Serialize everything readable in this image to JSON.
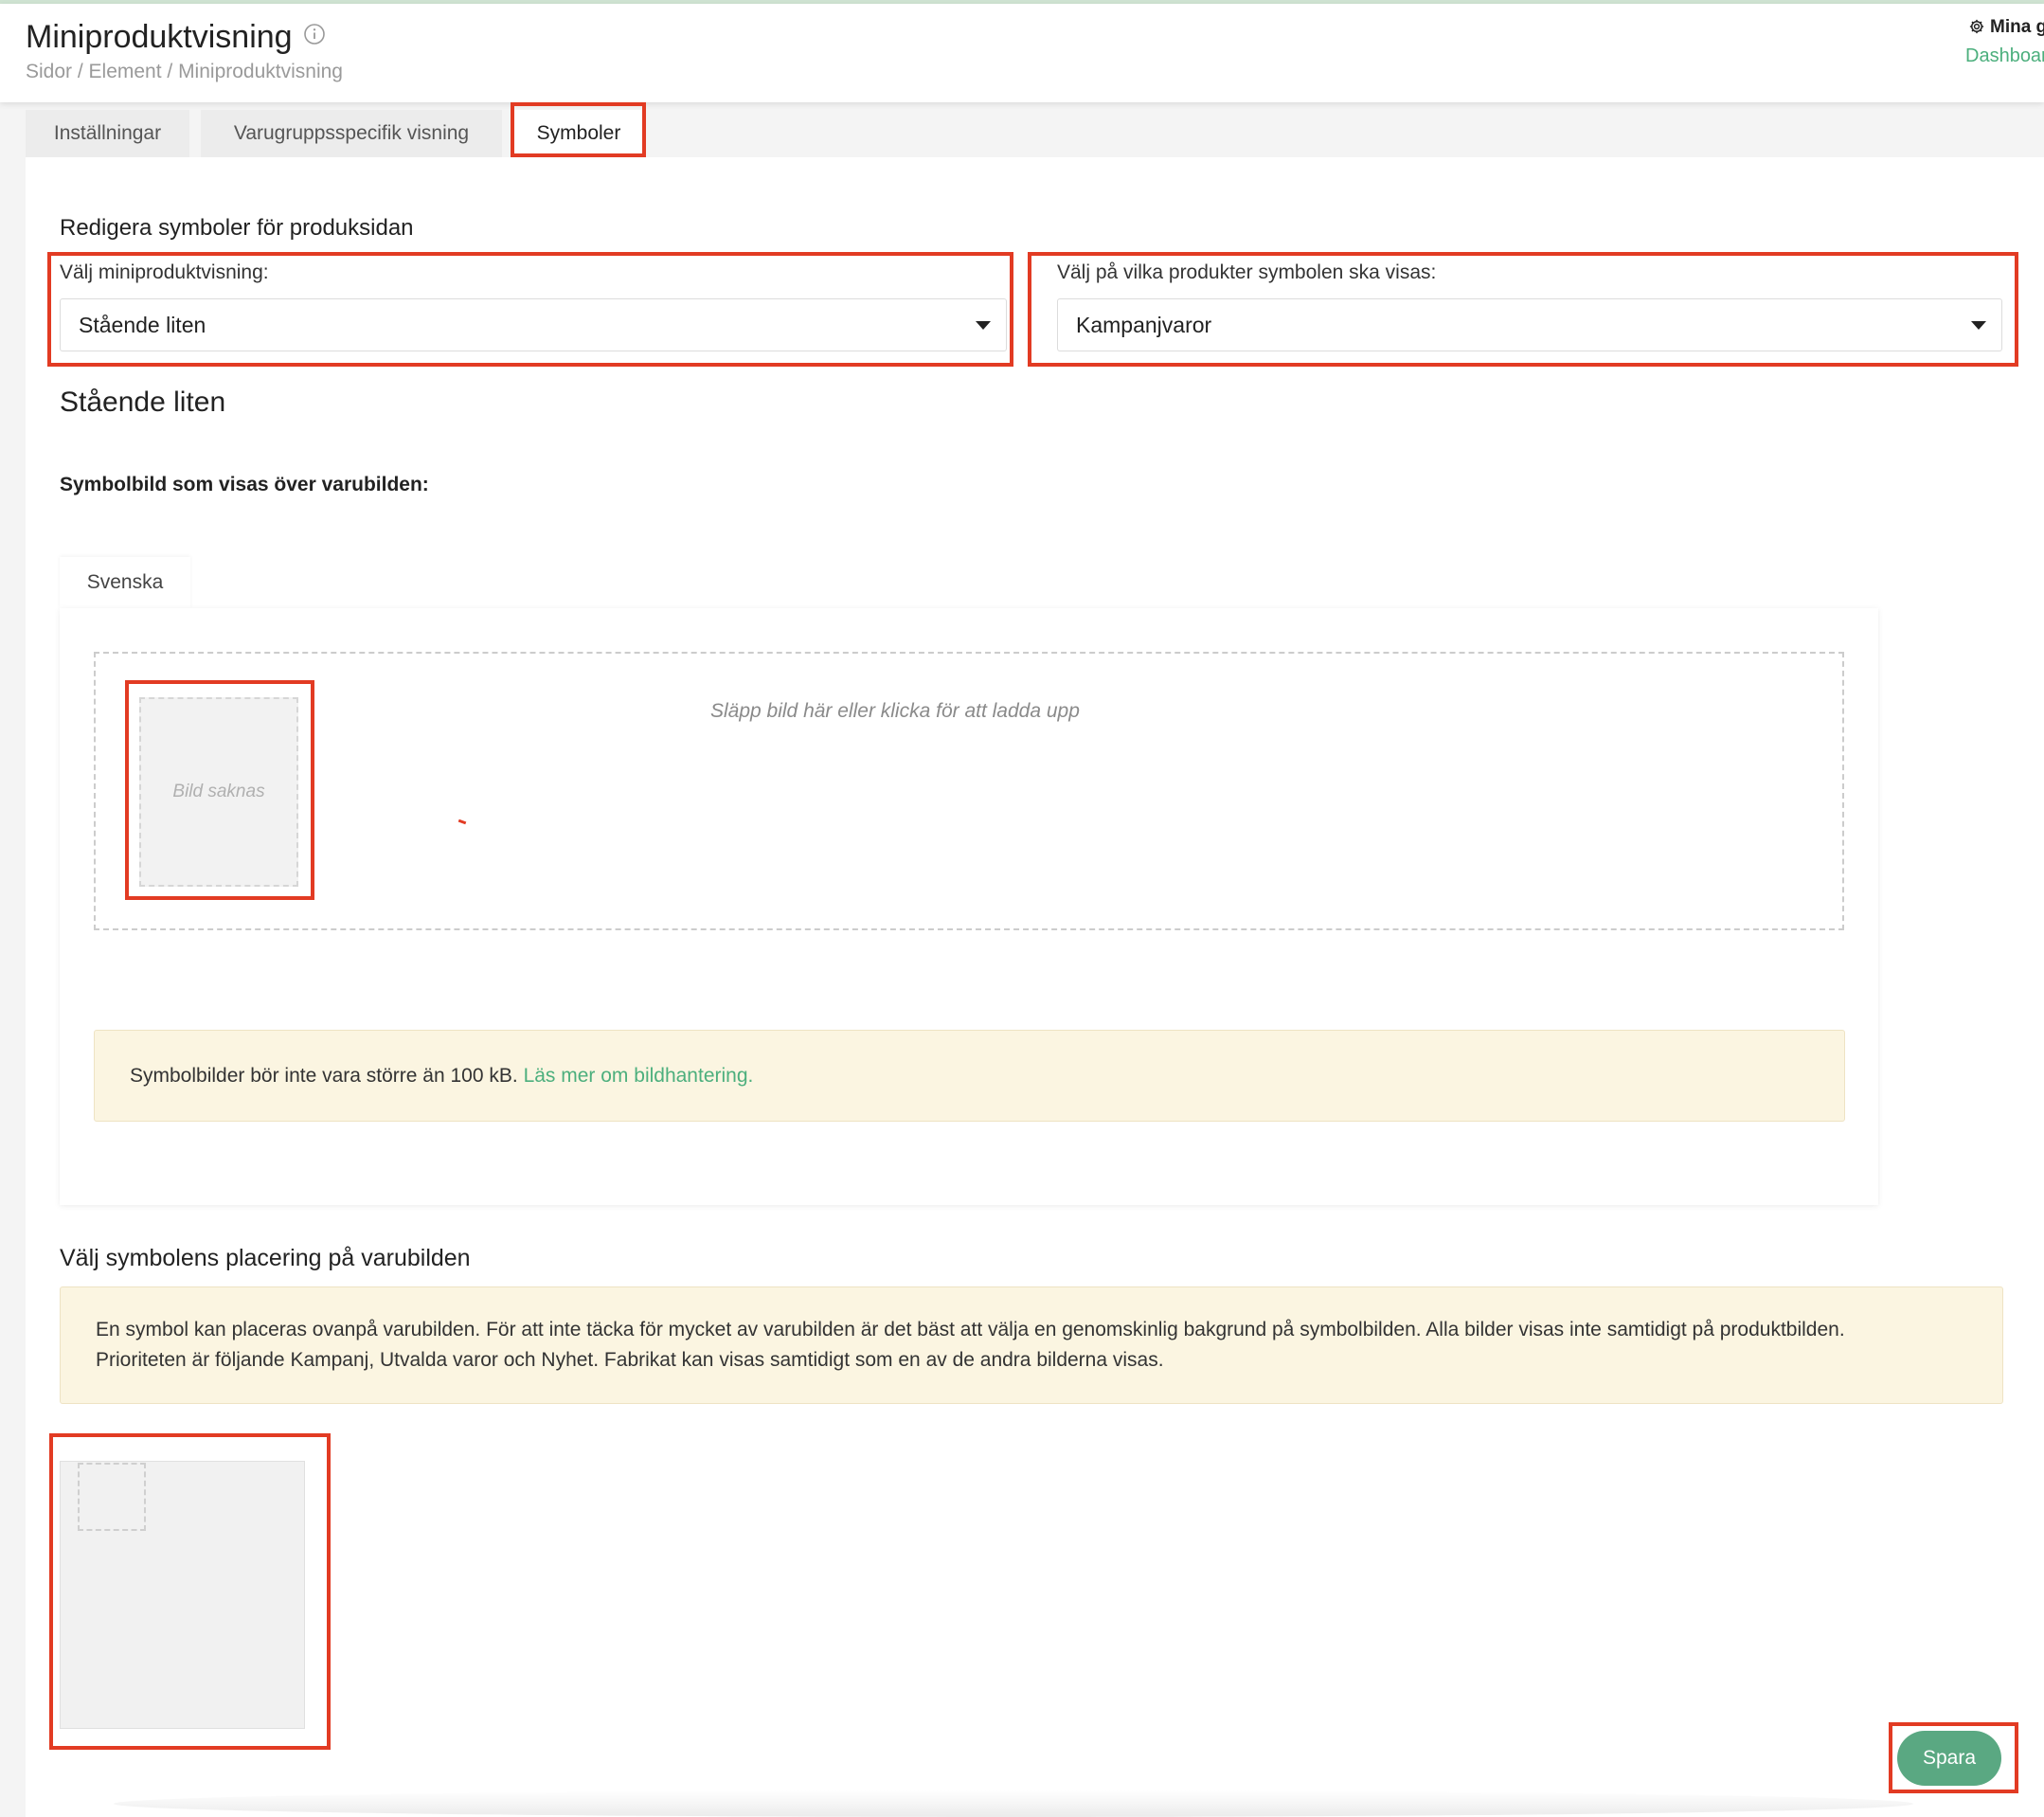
{
  "header": {
    "title": "Miniproduktvisning",
    "breadcrumb": "Sidor / Element / Miniproduktvisning",
    "top_right_label": "Mina g",
    "top_right_link": "Dashboar"
  },
  "tabs": [
    {
      "label": "Inställningar",
      "active": false
    },
    {
      "label": "Varugruppsspecifik visning",
      "active": false
    },
    {
      "label": "Symboler",
      "active": true
    }
  ],
  "section": {
    "heading": "Redigera symboler för produksidan",
    "miniview_label": "Välj miniproduktvisning:",
    "miniview_value": "Stående liten",
    "products_label": "Välj på vilka produkter symbolen ska visas:",
    "products_value": "Kampanjvaror",
    "subheading": "Stående liten",
    "symbol_label": "Symbolbild som visas över varubilden:",
    "language_tab": "Svenska",
    "dropzone_text": "Släpp bild här eller klicka för att ladda upp",
    "missing_image_text": "Bild saknas",
    "size_note": "Symbolbilder bör inte vara större än 100 kB.",
    "size_note_link": "Läs mer om bildhantering."
  },
  "placement": {
    "heading": "Välj symbolens placering på varubilden",
    "note_line1": "En symbol kan placeras ovanpå varubilden. För att inte täcka för mycket av varubilden är det bäst att välja en genomskinlig bakgrund på symbolbilden. Alla bilder visas inte samtidigt på produktbilden.",
    "note_line2": "Prioriteten är följande Kampanj, Utvalda varor och Nyhet. Fabrikat kan visas samtidigt som en av de andra bilderna visas."
  },
  "actions": {
    "save_label": "Spara"
  },
  "colors": {
    "accent_green": "#4caf7d",
    "button_green": "#5aa882",
    "highlight_red": "#e23b23",
    "note_background": "#fbf5e1"
  }
}
